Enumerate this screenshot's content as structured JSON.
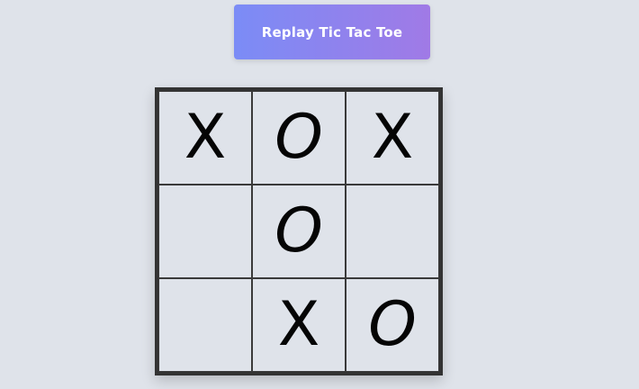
{
  "replay_button": {
    "label": "Replay Tic Tac Toe"
  },
  "board": {
    "cells": [
      {
        "mark": "X"
      },
      {
        "mark": "O"
      },
      {
        "mark": "X"
      },
      {
        "mark": ""
      },
      {
        "mark": "O"
      },
      {
        "mark": ""
      },
      {
        "mark": ""
      },
      {
        "mark": "X"
      },
      {
        "mark": "O"
      }
    ]
  },
  "colors": {
    "background": "#dfe3ea",
    "button_gradient_start": "#7b8cf6",
    "button_gradient_end": "#a07ae6",
    "board_border": "#333333",
    "mark": "#050505"
  }
}
